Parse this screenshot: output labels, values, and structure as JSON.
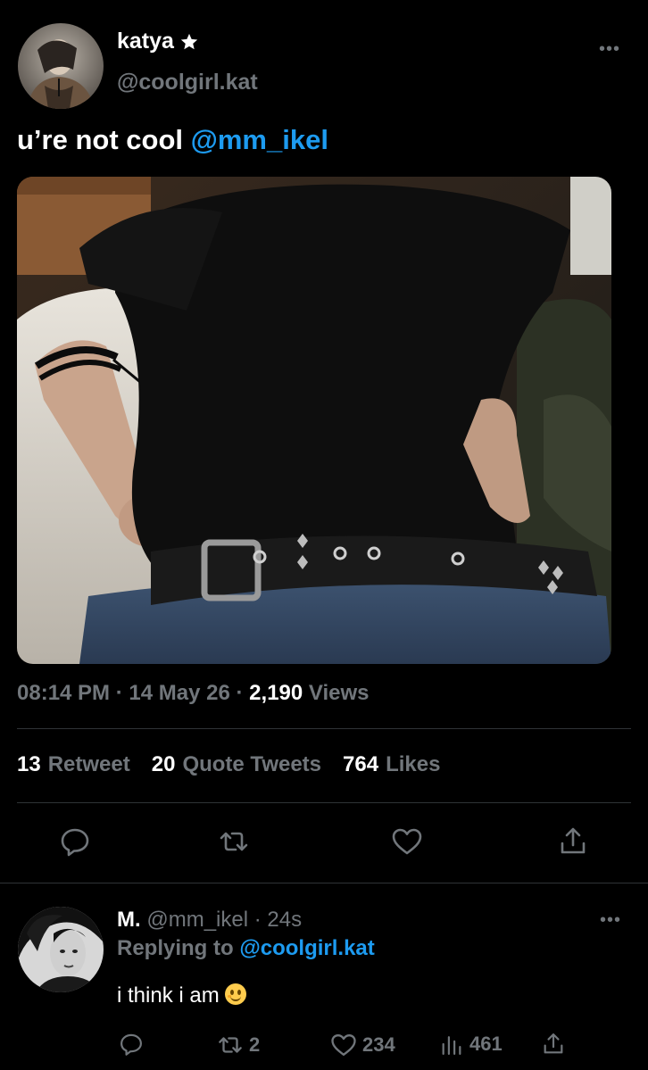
{
  "tweet": {
    "author_name": "katya",
    "author_handle": "@coolgirl.kat",
    "text": "u’re not cool",
    "mention": "@mm_ikel",
    "time": "08:14 PM",
    "date": "14 May 26",
    "views_count": "2,190",
    "views_label": "Views",
    "stats": [
      {
        "count": "13",
        "label": "Retweet"
      },
      {
        "count": "20",
        "label": "Quote Tweets"
      },
      {
        "count": "764",
        "label": "Likes"
      }
    ],
    "actions": [
      "reply-icon",
      "retweet-icon",
      "like-icon",
      "share-icon"
    ]
  },
  "reply": {
    "name": "M.",
    "handle": "@mm_ikel",
    "age": "24s",
    "replying_prefix": "Replying to",
    "replying_to": "@coolgirl.kat",
    "text": "i think i am",
    "counts": {
      "retweets": "2",
      "likes": "234",
      "views": "461"
    }
  },
  "colors": {
    "background": "#000000",
    "text": "#e7e9ea",
    "muted": "#71767b",
    "accent": "#1d9bf0",
    "divider": "#2f3336"
  }
}
